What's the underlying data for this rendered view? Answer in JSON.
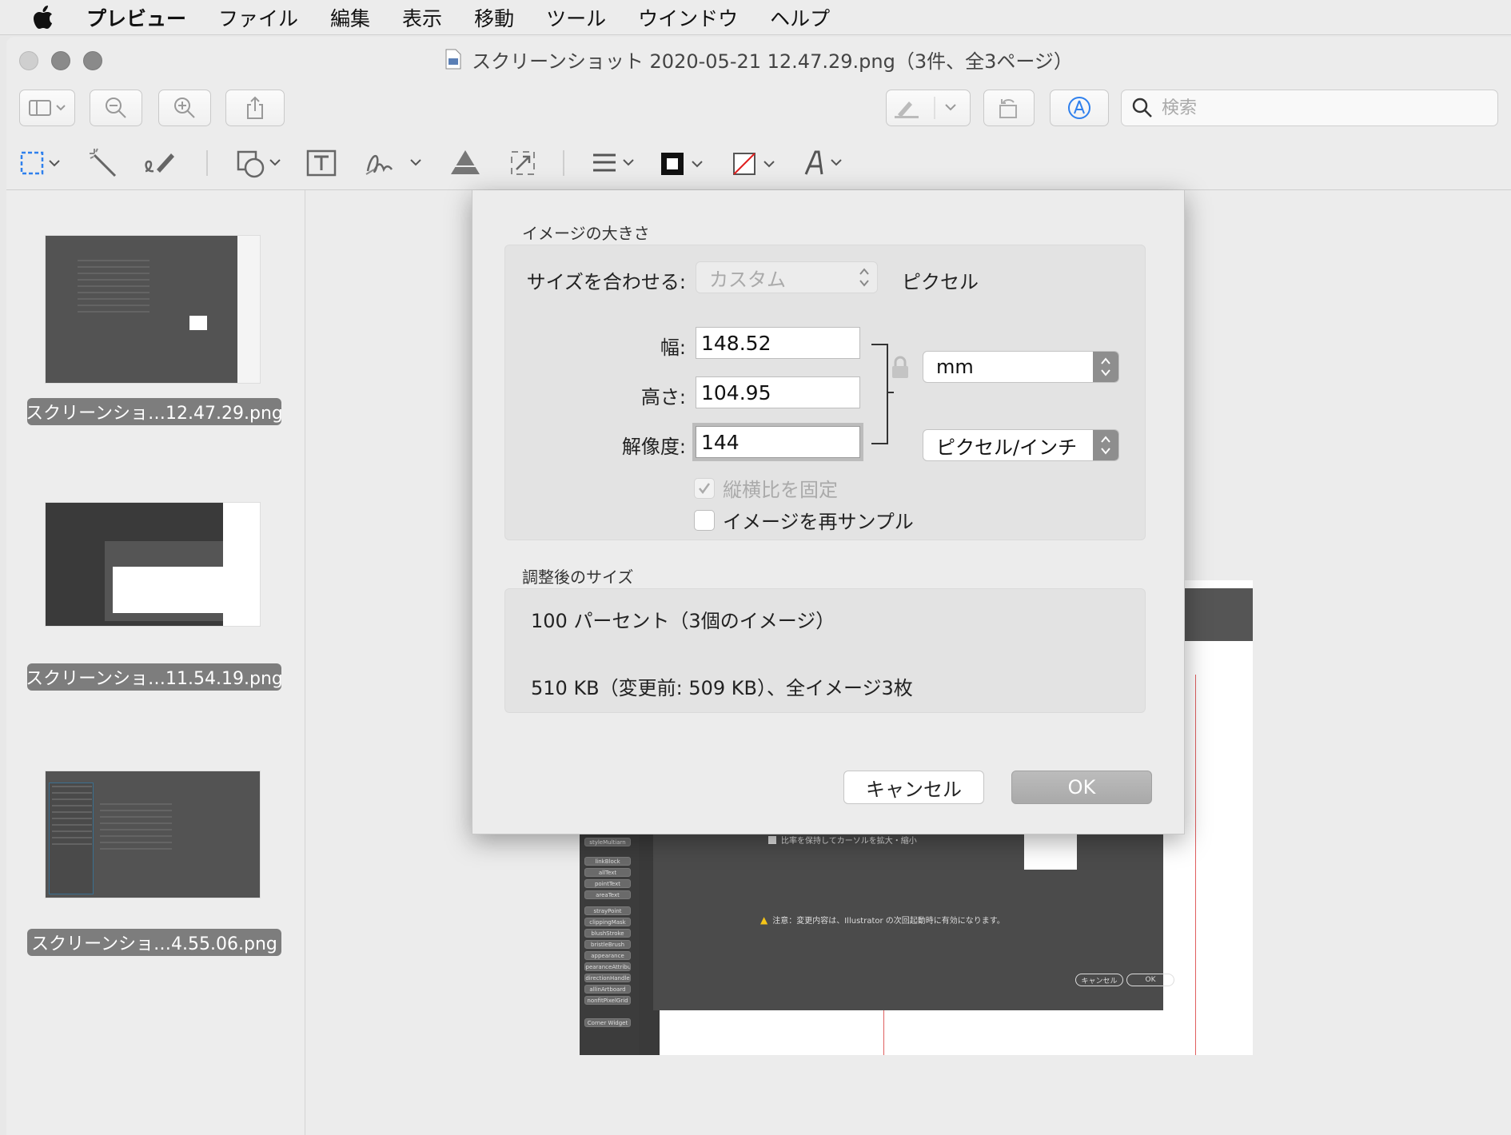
{
  "menubar": {
    "app": "プレビュー",
    "items": [
      "ファイル",
      "編集",
      "表示",
      "移動",
      "ツール",
      "ウインドウ",
      "ヘルプ"
    ]
  },
  "window": {
    "title": "スクリーンショット 2020-05-21 12.47.29.png（3件、全3ページ）"
  },
  "toolbar": {
    "search_placeholder": "検索",
    "icons": [
      "sidebar-icon",
      "zoom-out-icon",
      "zoom-in-icon",
      "share-icon",
      "highlight-pen-icon",
      "rotate-icon",
      "markup-icon",
      "search-icon"
    ]
  },
  "markup_toolbar": {
    "icons": [
      "rect-selection-icon",
      "instant-alpha-icon",
      "sketch-icon",
      "shapes-icon",
      "text-icon",
      "sign-icon",
      "adjust-color-icon",
      "adjust-size-icon",
      "shape-style-icon",
      "border-color-icon",
      "fill-color-icon",
      "text-style-icon"
    ]
  },
  "sidebar": {
    "items": [
      {
        "label": "スクリーンショ…12.47.29.png"
      },
      {
        "label": "スクリーンショ…11.54.19.png"
      },
      {
        "label": "スクリーンショ…4.55.06.png"
      }
    ]
  },
  "background_doc": {
    "panel_buttons": [
      "styleMultiarn",
      "linkBlock",
      "allText",
      "pointText",
      "areaText",
      "strayPoint",
      "clippingMask",
      "blushStroke",
      "bristleBrush",
      "appearance",
      "appearanceAttribute",
      "directionHandle",
      "allinArtboard",
      "nonfitPixelGrid",
      "Corner Widget"
    ],
    "checkbox_text": "比率を保持してカーソルを拡大・縮小",
    "warning_text": "注意：変更内容は、Illustrator の次回起動時に有効になります。",
    "cancel": "キャンセル",
    "ok": "OK"
  },
  "dialog": {
    "image_size_title": "イメージの大きさ",
    "fit_label": "サイズを合わせる:",
    "fit_value": "カスタム",
    "fit_unit": "ピクセル",
    "width_label": "幅:",
    "width_value": "148.52",
    "height_label": "高さ:",
    "height_value": "104.95",
    "resolution_label": "解像度:",
    "resolution_value": "144",
    "size_unit": "mm",
    "resolution_unit": "ピクセル/インチ",
    "keep_ratio_label": "縦横比を固定",
    "keep_ratio_checked": true,
    "resample_label": "イメージを再サンプル",
    "resample_checked": false,
    "result_title": "調整後のサイズ",
    "result_percent": "100 パーセント（3個のイメージ）",
    "result_size": "510 KB（変更前: 509 KB）、全イメージ3枚",
    "cancel_label": "キャンセル",
    "ok_label": "OK"
  }
}
